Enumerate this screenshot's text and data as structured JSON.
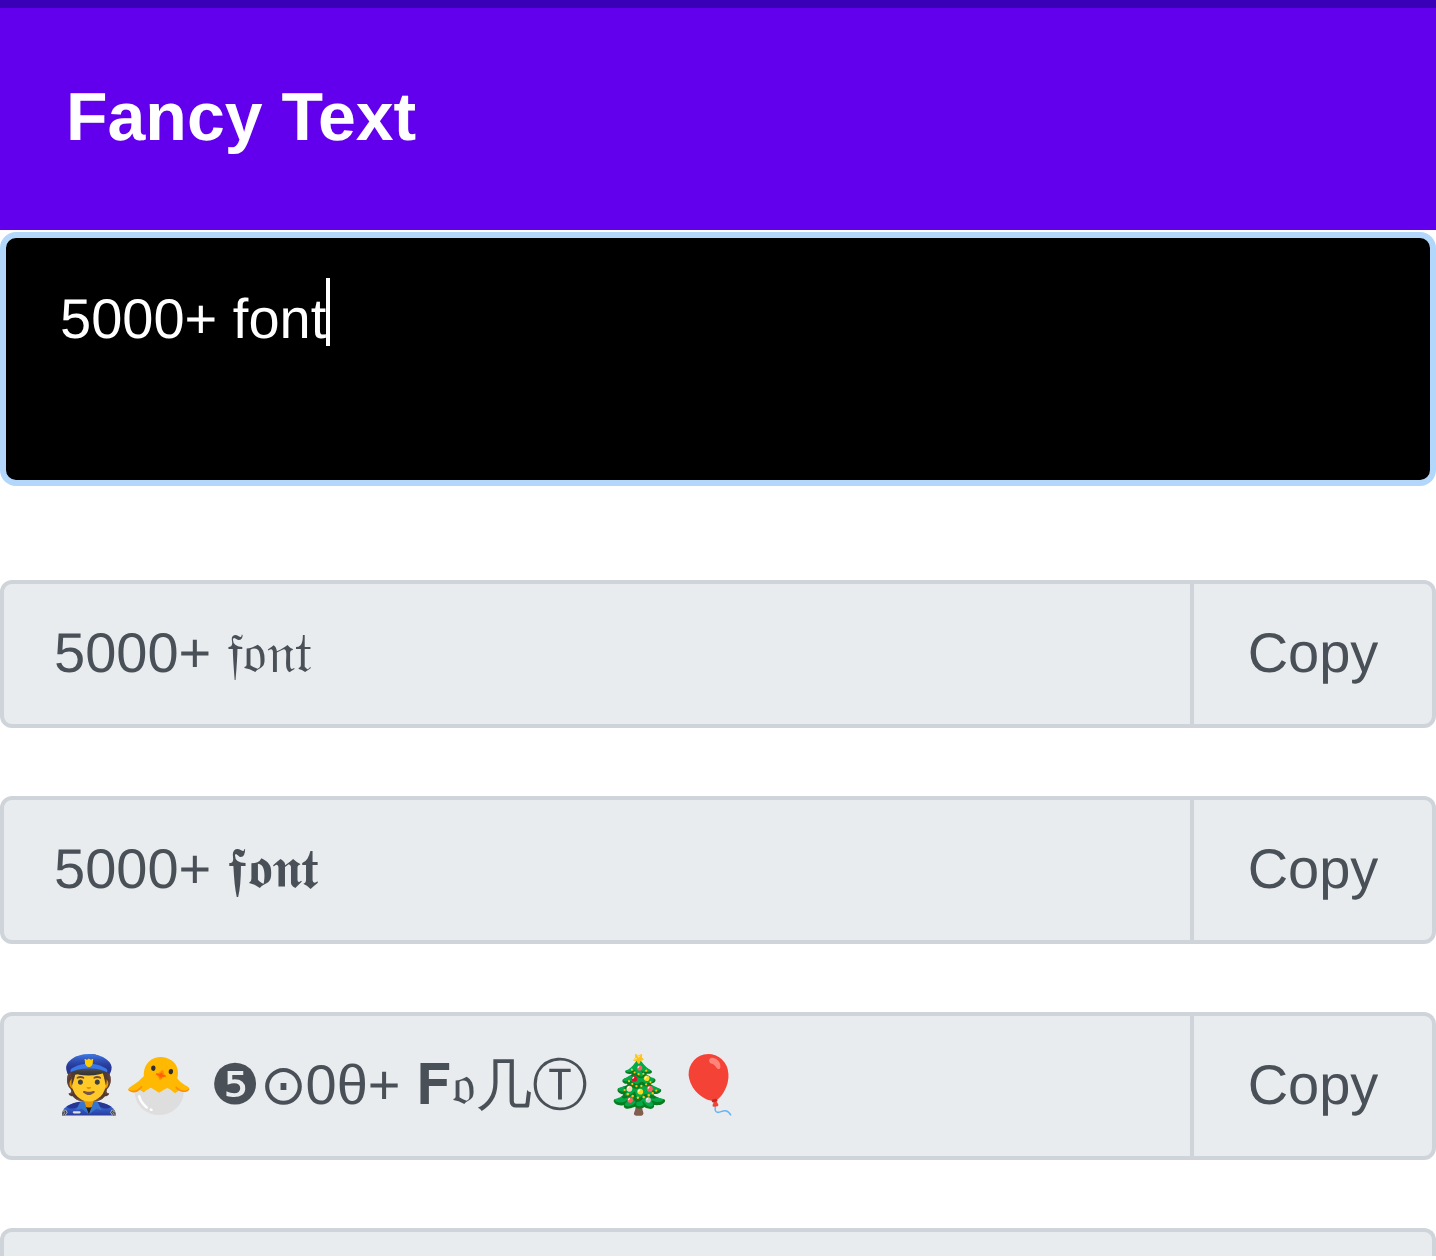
{
  "app_bar": {
    "title": "Fancy Text"
  },
  "input": {
    "value": "5000+ font",
    "focused": true
  },
  "results": [
    {
      "text": "5000+ 𝔣𝔬𝔫𝔱",
      "button": "Copy"
    },
    {
      "text": "5000+ 𝖋𝖔𝖓𝖙",
      "button": "Copy"
    },
    {
      "text": "👮🐣  ❺⊙0θ+ 𝐅𝔬几Ⓣ  🎄🎈",
      "button": "Copy"
    }
  ],
  "more_results_below": true
}
